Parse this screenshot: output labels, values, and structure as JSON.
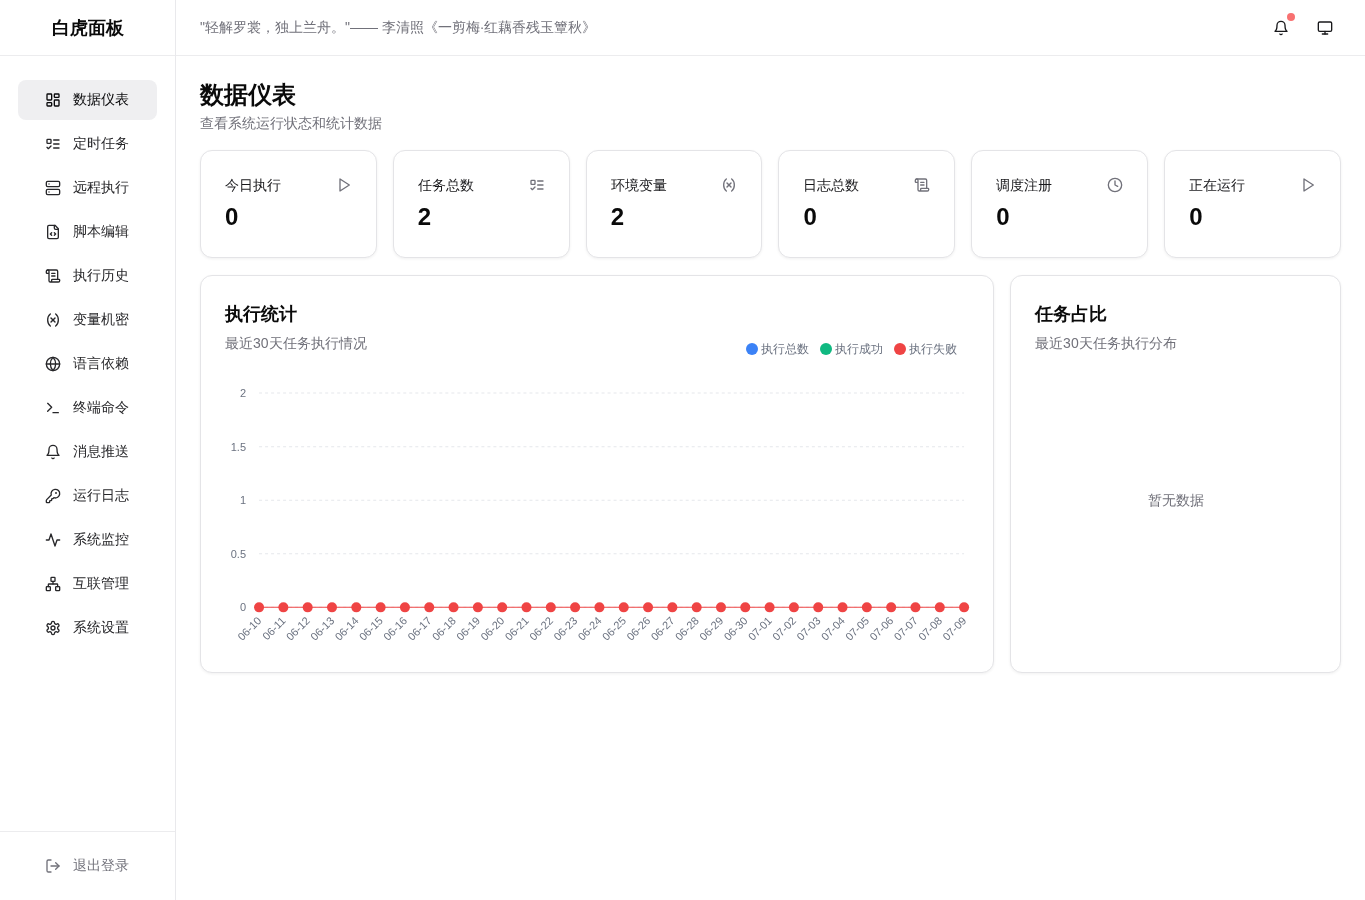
{
  "sidebar": {
    "brand": "白虎面板",
    "items": [
      {
        "label": "数据仪表",
        "selected": true
      },
      {
        "label": "定时任务",
        "selected": false
      },
      {
        "label": "远程执行",
        "selected": false
      },
      {
        "label": "脚本编辑",
        "selected": false
      },
      {
        "label": "执行历史",
        "selected": false
      },
      {
        "label": "变量机密",
        "selected": false
      },
      {
        "label": "语言依赖",
        "selected": false
      },
      {
        "label": "终端命令",
        "selected": false
      },
      {
        "label": "消息推送",
        "selected": false
      },
      {
        "label": "运行日志",
        "selected": false
      },
      {
        "label": "系统监控",
        "selected": false
      },
      {
        "label": "互联管理",
        "selected": false
      },
      {
        "label": "系统设置",
        "selected": false
      }
    ],
    "logout": "退出登录"
  },
  "header": {
    "quote": "\"轻解罗裳，独上兰舟。\"—— 李清照《一剪梅·红藕香残玉簟秋》",
    "unread_notifications": true
  },
  "page": {
    "title": "数据仪表",
    "subtitle": "查看系统运行状态和统计数据"
  },
  "stats": [
    {
      "label": "今日执行",
      "value": "0"
    },
    {
      "label": "任务总数",
      "value": "2"
    },
    {
      "label": "环境变量",
      "value": "2"
    },
    {
      "label": "日志总数",
      "value": "0"
    },
    {
      "label": "调度注册",
      "value": "0"
    },
    {
      "label": "正在运行",
      "value": "0"
    }
  ],
  "execution_chart": {
    "title": "执行统计",
    "subtitle": "最近30天任务执行情况",
    "chart_data": {
      "type": "line",
      "categories": [
        "06-10",
        "06-11",
        "06-12",
        "06-13",
        "06-14",
        "06-15",
        "06-16",
        "06-17",
        "06-18",
        "06-19",
        "06-20",
        "06-21",
        "06-22",
        "06-23",
        "06-24",
        "06-25",
        "06-26",
        "06-27",
        "06-28",
        "06-29",
        "06-30",
        "07-01",
        "07-02",
        "07-03",
        "07-04",
        "07-05",
        "07-06",
        "07-07",
        "07-08",
        "07-09"
      ],
      "series": [
        {
          "name": "执行总数",
          "color": "#3b82f6",
          "values": [
            null,
            null,
            null,
            null,
            null,
            null,
            null,
            null,
            null,
            null,
            null,
            null,
            null,
            null,
            null,
            null,
            null,
            null,
            null,
            null,
            null,
            null,
            null,
            null,
            null,
            null,
            null,
            null,
            null,
            null
          ]
        },
        {
          "name": "执行成功",
          "color": "#10b981",
          "values": [
            null,
            null,
            null,
            null,
            null,
            null,
            null,
            null,
            null,
            null,
            null,
            null,
            null,
            null,
            null,
            null,
            null,
            null,
            null,
            null,
            null,
            null,
            null,
            null,
            null,
            null,
            null,
            null,
            null,
            null
          ]
        },
        {
          "name": "执行失败",
          "color": "#ef4444",
          "marker": "circle",
          "values": [
            0,
            0,
            0,
            0,
            0,
            0,
            0,
            0,
            0,
            0,
            0,
            0,
            0,
            0,
            0,
            0,
            0,
            0,
            0,
            0,
            0,
            0,
            0,
            0,
            0,
            0,
            0,
            0,
            0,
            0
          ]
        }
      ],
      "ylim": [
        0,
        2
      ],
      "yticks": [
        0,
        0.5,
        1,
        1.5,
        2
      ],
      "grid": true
    }
  },
  "task_share": {
    "title": "任务占比",
    "subtitle": "最近30天任务执行分布",
    "empty_text": "暂无数据"
  }
}
